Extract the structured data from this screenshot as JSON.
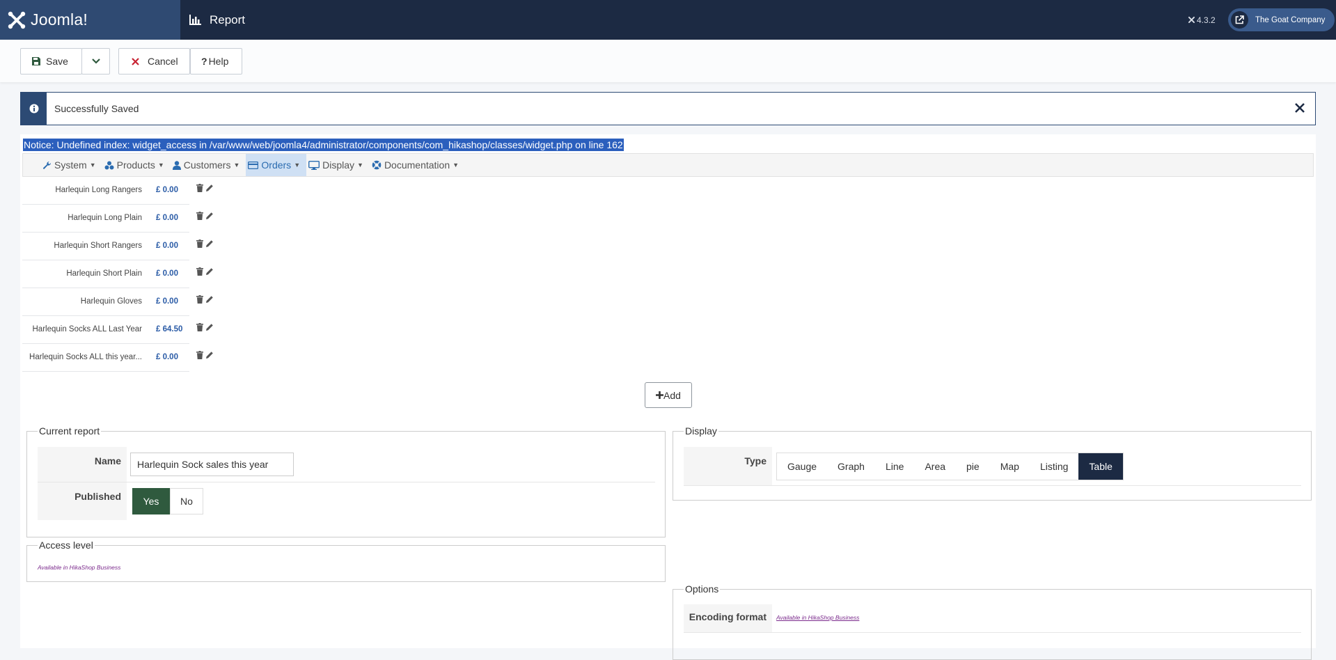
{
  "header": {
    "logo_text": "Joomla!",
    "page_title": "Report",
    "version": "4.3.2",
    "site_name": "The Goat Company"
  },
  "toolbar": {
    "save_label": "Save",
    "cancel_label": "Cancel",
    "help_label": "Help"
  },
  "alert": {
    "message": "Successfully Saved"
  },
  "notice": "Notice: Undefined index: widget_access in /var/www/web/joomla4/administrator/components/com_hikashop/classes/widget.php on line 162",
  "menu": {
    "system": "System",
    "products": "Products",
    "customers": "Customers",
    "orders": "Orders",
    "display": "Display",
    "documentation": "Documentation"
  },
  "widgets": [
    {
      "name": "Harlequin Long Rangers",
      "value": "£ 0.00"
    },
    {
      "name": "Harlequin Long Plain",
      "value": "£ 0.00"
    },
    {
      "name": "Harlequin Short Rangers",
      "value": "£ 0.00"
    },
    {
      "name": "Harlequin Short Plain",
      "value": "£ 0.00"
    },
    {
      "name": "Harlequin Gloves",
      "value": "£ 0.00"
    },
    {
      "name": "Harlequin Socks ALL Last Year",
      "value": "£ 64.50"
    },
    {
      "name": "Harlequin Socks ALL this year...",
      "value": "£ 0.00"
    }
  ],
  "add_label": "Add",
  "current_report": {
    "legend": "Current report",
    "name_label": "Name",
    "name_value": "Harlequin Sock sales this year",
    "published_label": "Published",
    "yes": "Yes",
    "no": "No"
  },
  "access_level": {
    "legend": "Access level",
    "note": "Available in HikaShop Business"
  },
  "display": {
    "legend": "Display",
    "type_label": "Type",
    "types": [
      "Gauge",
      "Graph",
      "Line",
      "Area",
      "pie",
      "Map",
      "Listing",
      "Table"
    ],
    "selected": "Table"
  },
  "options": {
    "legend": "Options",
    "encoding_label": "Encoding format",
    "encoding_note": "Available in HikaShop Business"
  },
  "colors": {
    "header_bg": "#1c2a43",
    "logo_bg": "#2f4a72",
    "published_yes": "#2f5a3e",
    "selected_type": "#1c2a43",
    "notice_highlight": "#2b5fbd"
  }
}
